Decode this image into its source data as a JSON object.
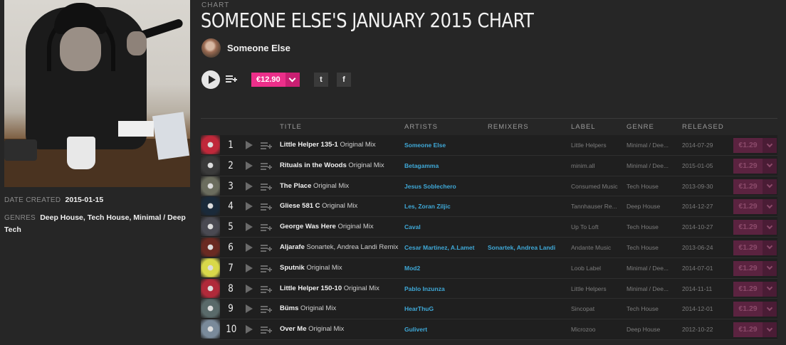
{
  "header": {
    "kicker": "CHART",
    "title": "SOMEONE ELSE'S JANUARY 2015 CHART",
    "artist": "Someone Else",
    "price": "€12.90",
    "twitter_glyph": "t",
    "facebook_glyph": "f"
  },
  "meta": {
    "date_label": "DATE CREATED",
    "date_value": "2015-01-15",
    "genres_label": "GENRES",
    "genres_value": "Deep House, Tech House, Minimal / Deep Tech"
  },
  "columns": {
    "title": "TITLE",
    "artists": "ARTISTS",
    "remixers": "REMIXERS",
    "label": "LABEL",
    "genre": "GENRE",
    "released": "RELEASED"
  },
  "tracks": [
    {
      "num": "1",
      "title": "Little Helper 135-1",
      "mix": "Original Mix",
      "artists": "Someone Else",
      "remixers": "",
      "label": "Little Helpers",
      "genre": "Minimal / Dee...",
      "released": "2014-07-29",
      "price": "€1.29",
      "art_color": "#c0283a"
    },
    {
      "num": "2",
      "title": "Rituals in the Woods",
      "mix": "Original Mix",
      "artists": "Betagamma",
      "remixers": "",
      "label": "minim.all",
      "genre": "Minimal / Dee...",
      "released": "2015-01-05",
      "price": "€1.29",
      "art_color": "#3a3a3a"
    },
    {
      "num": "3",
      "title": "The Place",
      "mix": "Original Mix",
      "artists": "Jesus Soblechero",
      "remixers": "",
      "label": "Consumed Music",
      "genre": "Tech House",
      "released": "2013-09-30",
      "price": "€1.29",
      "art_color": "#6b6d5e"
    },
    {
      "num": "4",
      "title": "Gliese 581 C",
      "mix": "Original Mix",
      "artists": "Les, Zoran Ziljic",
      "remixers": "",
      "label": "Tannhauser Re...",
      "genre": "Deep House",
      "released": "2014-12-27",
      "price": "€1.29",
      "art_color": "#1a2a3a"
    },
    {
      "num": "5",
      "title": "George Was Here",
      "mix": "Original Mix",
      "artists": "Caval",
      "remixers": "",
      "label": "Up To Loft",
      "genre": "Tech House",
      "released": "2014-10-27",
      "price": "€1.29",
      "art_color": "#4a4a52"
    },
    {
      "num": "6",
      "title": "Aljarafe",
      "mix": "Sonartek, Andrea Landi Remix",
      "artists": "Cesar Martinez, A.Lamet",
      "remixers": "Sonartek, Andrea Landi",
      "label": "Andante Music",
      "genre": "Tech House",
      "released": "2013-06-24",
      "price": "€1.29",
      "art_color": "#6a2a22"
    },
    {
      "num": "7",
      "title": "Sputnik",
      "mix": "Original Mix",
      "artists": "Mod2",
      "remixers": "",
      "label": "Loob Label",
      "genre": "Minimal / Dee...",
      "released": "2014-07-01",
      "price": "€1.29",
      "art_color": "#d8d84a"
    },
    {
      "num": "8",
      "title": "Little Helper 150-10",
      "mix": "Original Mix",
      "artists": "Pablo Inzunza",
      "remixers": "",
      "label": "Little Helpers",
      "genre": "Minimal / Dee...",
      "released": "2014-11-11",
      "price": "€1.29",
      "art_color": "#b02a3a"
    },
    {
      "num": "9",
      "title": "Büms",
      "mix": "Original Mix",
      "artists": "HearThuG",
      "remixers": "",
      "label": "Sincopat",
      "genre": "Tech House",
      "released": "2014-12-01",
      "price": "€1.29",
      "art_color": "#5a6a6a"
    },
    {
      "num": "10",
      "title": "Over Me",
      "mix": "Original Mix",
      "artists": "Gulivert",
      "remixers": "",
      "label": "Microzoo",
      "genre": "Deep House",
      "released": "2012-10-22",
      "price": "€1.29",
      "art_color": "#7a8a9a"
    }
  ]
}
